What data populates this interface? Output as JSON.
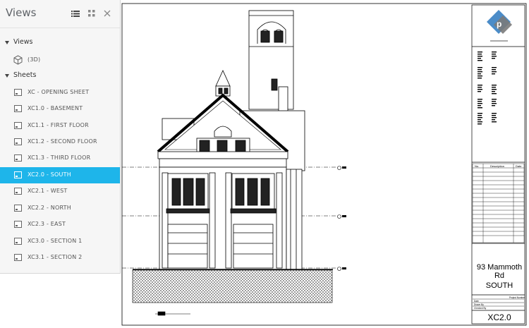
{
  "panel": {
    "title": "Views",
    "groups": [
      {
        "label": "Views",
        "items": [
          {
            "label": "(3D)",
            "icon": "cube-icon"
          }
        ]
      },
      {
        "label": "Sheets",
        "items": [
          {
            "label": "XC - OPENING SHEET"
          },
          {
            "label": "XC1.0 - BASEMENT"
          },
          {
            "label": "XC1.1 - FIRST FLOOR"
          },
          {
            "label": "XC1.2 - SECOND FLOOR"
          },
          {
            "label": "XC1.3 - THIRD FLOOR"
          },
          {
            "label": "XC2.0 - SOUTH",
            "selected": true
          },
          {
            "label": "XC2.1 - WEST"
          },
          {
            "label": "XC2.2 - NORTH"
          },
          {
            "label": "XC2.3 - EAST"
          },
          {
            "label": "XC3.0 - SECTION 1"
          },
          {
            "label": "XC3.1 - SECTION 2"
          }
        ]
      }
    ],
    "header_icons": [
      "list-view-icon",
      "grid-view-icon",
      "close-icon"
    ]
  },
  "titleblock": {
    "project_name": "93 Mammoth Rd",
    "sheet_name": "SOUTH",
    "sheet_number": "XC2.0",
    "revision_headers": [
      "No.",
      "Description",
      "Date"
    ],
    "fields": [
      "Project Number",
      "Date",
      "Drawn By",
      "Checked By"
    ]
  },
  "colors": {
    "selection": "#1eb5ea",
    "logo_blue": "#4b8cc8",
    "logo_gray": "#7a7a7a",
    "panel_bg": "#f6f6f6"
  }
}
